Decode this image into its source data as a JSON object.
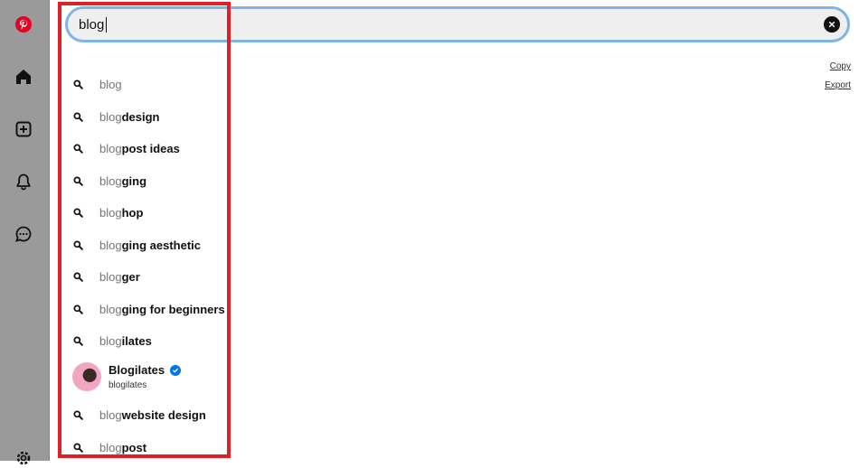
{
  "search": {
    "value": "blog",
    "clear_icon": "close-icon"
  },
  "sidebar": {
    "items": [
      {
        "icon": "pinterest-logo-icon",
        "color": "#e60023"
      },
      {
        "icon": "home-icon"
      },
      {
        "icon": "create-plus-icon"
      },
      {
        "icon": "notifications-bell-icon"
      },
      {
        "icon": "messages-chat-icon"
      },
      {
        "icon": "settings-gear-icon"
      }
    ]
  },
  "actions": {
    "copy_label": "Copy",
    "export_label": "Export"
  },
  "suggestions": [
    {
      "typed": "blog",
      "rest": ""
    },
    {
      "typed": "blog",
      "rest": " design"
    },
    {
      "typed": "blog",
      "rest": " post ideas"
    },
    {
      "typed": "blog",
      "rest": "ging"
    },
    {
      "typed": "blog",
      "rest": " hop"
    },
    {
      "typed": "blog",
      "rest": "ging aesthetic"
    },
    {
      "typed": "blog",
      "rest": "ger"
    },
    {
      "typed": "blog",
      "rest": "ging for beginners"
    },
    {
      "typed": "blog",
      "rest": "ilates"
    },
    {
      "typed": "blog",
      "rest": " website design"
    },
    {
      "typed": "blog",
      "rest": " post"
    }
  ],
  "profile": {
    "name": "Blogilates",
    "handle": "blogilates",
    "verified": true
  },
  "colors": {
    "highlight": "#e02027",
    "search_focus": "#7fb4e6",
    "brand": "#e60023",
    "verified": "#0074e8"
  }
}
